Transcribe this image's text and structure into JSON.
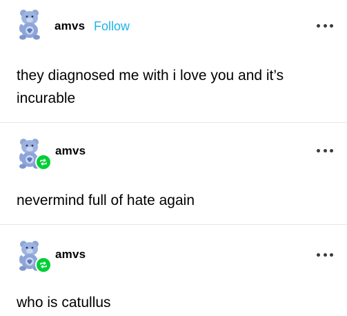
{
  "posts": [
    {
      "username": "amvs",
      "follow_label": "Follow",
      "text": "they diagnosed me with  i love you and it’s incurable",
      "avatar_icon": "blue-bear-avatar-icon",
      "menu_icon": "more-options-icon"
    },
    {
      "username": "amvs",
      "text": "nevermind full of hate again",
      "avatar_icon": "blue-bear-avatar-icon",
      "badge_icon": "reblog-icon",
      "menu_icon": "more-options-icon"
    },
    {
      "username": "amvs",
      "text": "who is catullus",
      "avatar_icon": "blue-bear-avatar-icon",
      "badge_icon": "reblog-icon",
      "menu_icon": "more-options-icon"
    }
  ],
  "colors": {
    "follow": "#1db4e8",
    "reblog_badge": "#00cf35",
    "divider": "#e6e6e6"
  }
}
